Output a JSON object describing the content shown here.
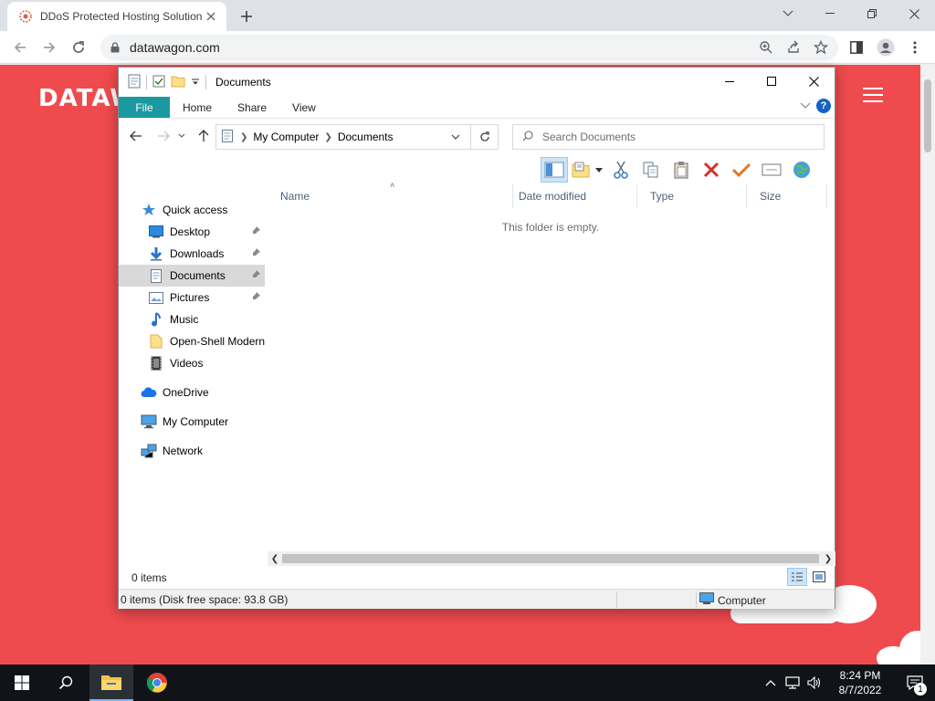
{
  "browser": {
    "tab_title": "DDoS Protected Hosting Solution",
    "url": "datawagon.com"
  },
  "website": {
    "logo_text": "DATAW",
    "brand_color": "#ef4b4e"
  },
  "explorer": {
    "title": "Documents",
    "ribbon_tabs": [
      "File",
      "Home",
      "Share",
      "View"
    ],
    "breadcrumb": [
      "My Computer",
      "Documents"
    ],
    "search_placeholder": "Search Documents",
    "nav_items": [
      {
        "label": "Quick access",
        "icon": "star-icon"
      },
      {
        "label": "Desktop",
        "icon": "desktop-icon",
        "pinned": true
      },
      {
        "label": "Downloads",
        "icon": "download-icon",
        "pinned": true
      },
      {
        "label": "Documents",
        "icon": "document-icon",
        "pinned": true,
        "selected": true
      },
      {
        "label": "Pictures",
        "icon": "pictures-icon",
        "pinned": true
      },
      {
        "label": "Music",
        "icon": "music-icon"
      },
      {
        "label": "Open-Shell Modern",
        "icon": "folder-icon"
      },
      {
        "label": "Videos",
        "icon": "video-icon"
      },
      {
        "label": "OneDrive",
        "icon": "cloud-icon"
      },
      {
        "label": "My Computer",
        "icon": "computer-icon"
      },
      {
        "label": "Network",
        "icon": "network-icon"
      }
    ],
    "columns": [
      "Name",
      "Date modified",
      "Type",
      "Size"
    ],
    "empty_message": "This folder is empty.",
    "status_items": "0 items",
    "status_bar_left": "0 items (Disk free space: 93.8 GB)",
    "status_bar_right": "Computer"
  },
  "taskbar": {
    "time": "8:24 PM",
    "date": "8/7/2022",
    "notification_count": "1"
  }
}
